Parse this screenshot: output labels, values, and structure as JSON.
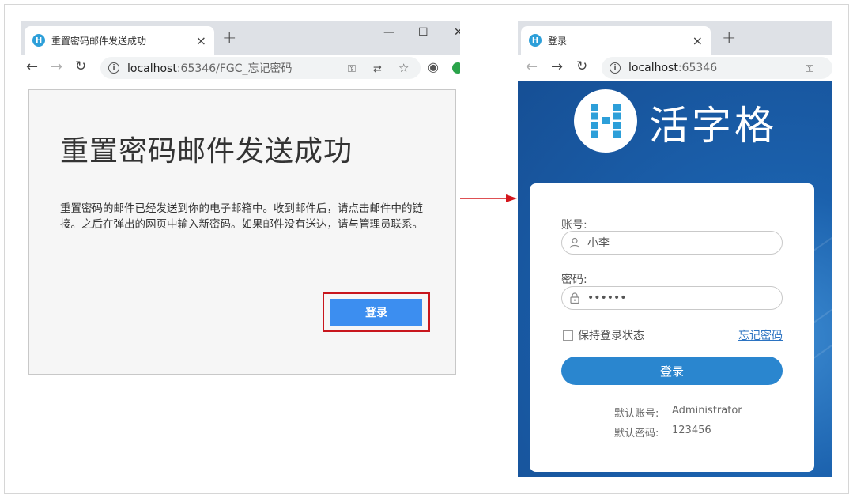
{
  "left_browser": {
    "tab_title": "重置密码邮件发送成功",
    "tab_close": "×",
    "new_tab": "+",
    "window_controls": {
      "minimize": "—",
      "maximize": "☐",
      "close": "✕"
    },
    "url_host": "localhost",
    "url_rest": ":65346/FGC_忘记密码",
    "heading": "重置密码邮件发送成功",
    "message": "重置密码的邮件已经发送到你的电子邮箱中。收到邮件后，请点击邮件中的链接。之后在弹出的网页中输入新密码。如果邮件没有送达，请与管理员联系。",
    "login_button": "登录"
  },
  "right_browser": {
    "tab_title": "登录",
    "tab_close": "×",
    "new_tab": "+",
    "url_host": "localhost",
    "url_rest": ":65346",
    "logo_text": "活字格",
    "account_label": "账号:",
    "account_value": "小李",
    "password_label": "密码:",
    "password_value": "••••••",
    "remember_label": "保持登录状态",
    "forgot_link": "忘记密码",
    "login_button": "登录",
    "default_account_label": "默认账号:",
    "default_account_value": "Administrator",
    "default_password_label": "默认密码:",
    "default_password_value": "123456"
  },
  "colors": {
    "accent_blue": "#3c8ef0",
    "highlight_red": "#c8161d",
    "login_button_blue": "#2a86cf",
    "background_blue": "#1b61ad"
  },
  "favicon": "H"
}
